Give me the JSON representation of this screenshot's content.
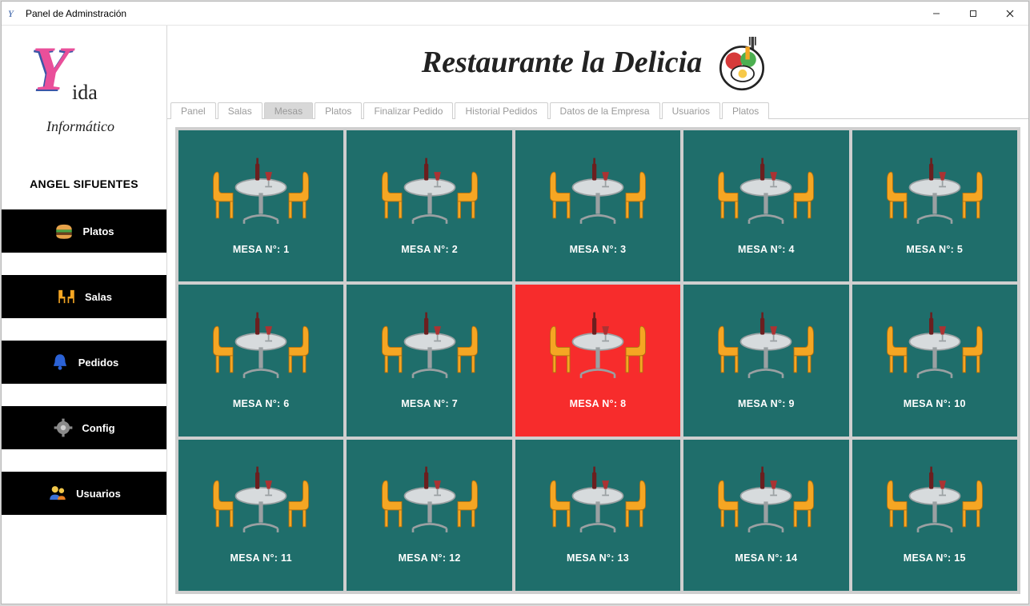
{
  "window": {
    "title": "Panel de Adminstración"
  },
  "sidebar": {
    "username": "ANGEL SIFUENTES",
    "items": [
      {
        "label": "Platos",
        "icon": "burger-icon"
      },
      {
        "label": "Salas",
        "icon": "chairs-icon"
      },
      {
        "label": "Pedidos",
        "icon": "bell-icon"
      },
      {
        "label": "Config",
        "icon": "gear-icon"
      },
      {
        "label": "Usuarios",
        "icon": "users-icon"
      }
    ]
  },
  "header": {
    "title": "Restaurante la Delicia"
  },
  "tabs": [
    {
      "label": "Panel",
      "active": false
    },
    {
      "label": "Salas",
      "active": false
    },
    {
      "label": "Mesas",
      "active": true
    },
    {
      "label": "Platos",
      "active": false
    },
    {
      "label": "Finalizar Pedido",
      "active": false
    },
    {
      "label": "Historial Pedidos",
      "active": false
    },
    {
      "label": "Datos de la Empresa",
      "active": false
    },
    {
      "label": "Usuarios",
      "active": false
    },
    {
      "label": "Platos",
      "active": false
    }
  ],
  "mesas": [
    {
      "label": "MESA N°: 1",
      "occupied": false
    },
    {
      "label": "MESA N°: 2",
      "occupied": false
    },
    {
      "label": "MESA N°: 3",
      "occupied": false
    },
    {
      "label": "MESA N°: 4",
      "occupied": false
    },
    {
      "label": "MESA N°: 5",
      "occupied": false
    },
    {
      "label": "MESA N°: 6",
      "occupied": false
    },
    {
      "label": "MESA N°: 7",
      "occupied": false
    },
    {
      "label": "MESA N°: 8",
      "occupied": true
    },
    {
      "label": "MESA N°: 9",
      "occupied": false
    },
    {
      "label": "MESA N°: 10",
      "occupied": false
    },
    {
      "label": "MESA N°: 11",
      "occupied": false
    },
    {
      "label": "MESA N°: 12",
      "occupied": false
    },
    {
      "label": "MESA N°: 13",
      "occupied": false
    },
    {
      "label": "MESA N°: 14",
      "occupied": false
    },
    {
      "label": "MESA N°: 15",
      "occupied": false
    }
  ],
  "colors": {
    "mesa_free": "#1f6e6b",
    "mesa_occupied": "#f72c2c",
    "chair": "#f5a623",
    "bell": "#2b62d6"
  }
}
